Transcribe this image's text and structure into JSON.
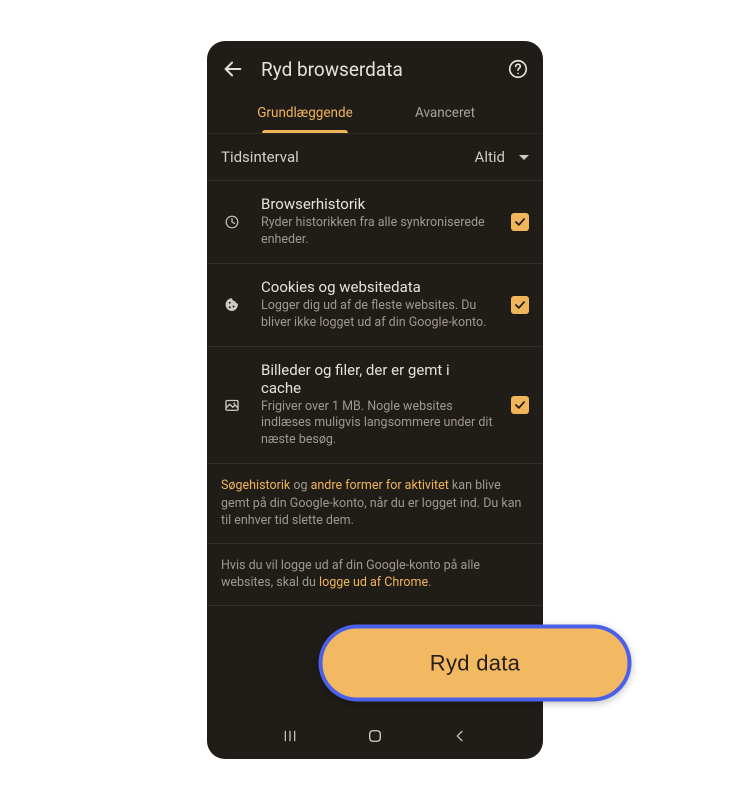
{
  "header": {
    "title": "Ryd browserdata"
  },
  "tabs": {
    "basic": "Grundlæggende",
    "advanced": "Avanceret"
  },
  "timeRange": {
    "label": "Tidsinterval",
    "value": "Altid"
  },
  "items": [
    {
      "title": "Browserhistorik",
      "desc": "Ryder historikken fra alle synkroniserede enheder.",
      "checked": true
    },
    {
      "title": "Cookies og websitedata",
      "desc": "Logger dig ud af de fleste websites. Du bliver ikke logget ud af din Google-konto.",
      "checked": true
    },
    {
      "title": "Billeder og filer, der er gemt i cache",
      "desc": "Frigiver over 1 MB. Nogle websites indlæses muligvis langsommere under dit næste besøg.",
      "checked": true
    }
  ],
  "info1": {
    "link1": "Søgehistorik",
    "mid1": " og ",
    "link2": "andre former for aktivitet",
    "rest": " kan blive gemt på din Google-konto, når du er logget ind. Du kan til enhver tid slette dem."
  },
  "info2": {
    "pre": "Hvis du vil logge ud af din Google-konto på alle websites, skal du ",
    "link": "logge ud af Chrome",
    "post": "."
  },
  "clearButton": "Ryd data"
}
